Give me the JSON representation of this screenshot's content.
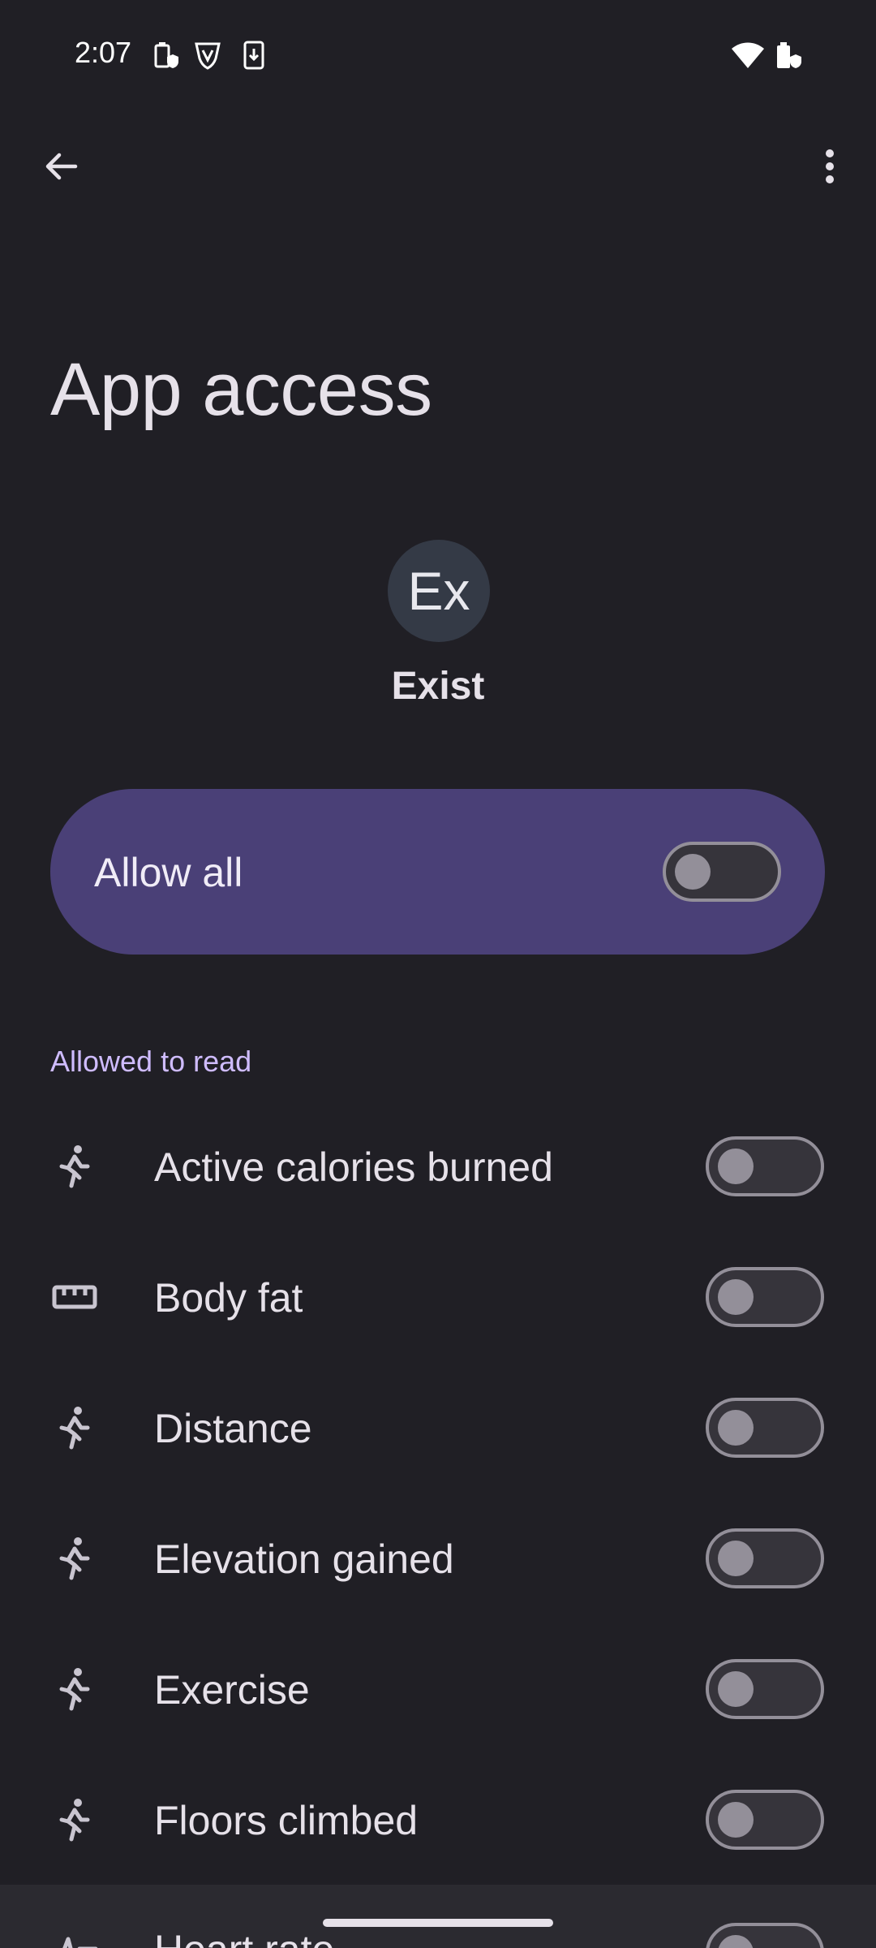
{
  "status_bar": {
    "time": "2:07"
  },
  "page": {
    "title": "App access"
  },
  "app": {
    "initials": "Ex",
    "name": "Exist"
  },
  "allow_all": {
    "label": "Allow all",
    "enabled": false
  },
  "section": {
    "header": "Allowed to read"
  },
  "permissions": [
    {
      "label": "Active calories burned",
      "icon": "activity-icon",
      "enabled": false
    },
    {
      "label": "Body fat",
      "icon": "ruler-icon",
      "enabled": false
    },
    {
      "label": "Distance",
      "icon": "activity-icon",
      "enabled": false
    },
    {
      "label": "Elevation gained",
      "icon": "activity-icon",
      "enabled": false
    },
    {
      "label": "Exercise",
      "icon": "activity-icon",
      "enabled": false
    },
    {
      "label": "Floors climbed",
      "icon": "activity-icon",
      "enabled": false
    },
    {
      "label": "Heart rate",
      "icon": "heart-rate-icon",
      "enabled": false
    }
  ],
  "colors": {
    "background": "#201f25",
    "card": "#4a4077",
    "accent": "#cfbcff"
  }
}
